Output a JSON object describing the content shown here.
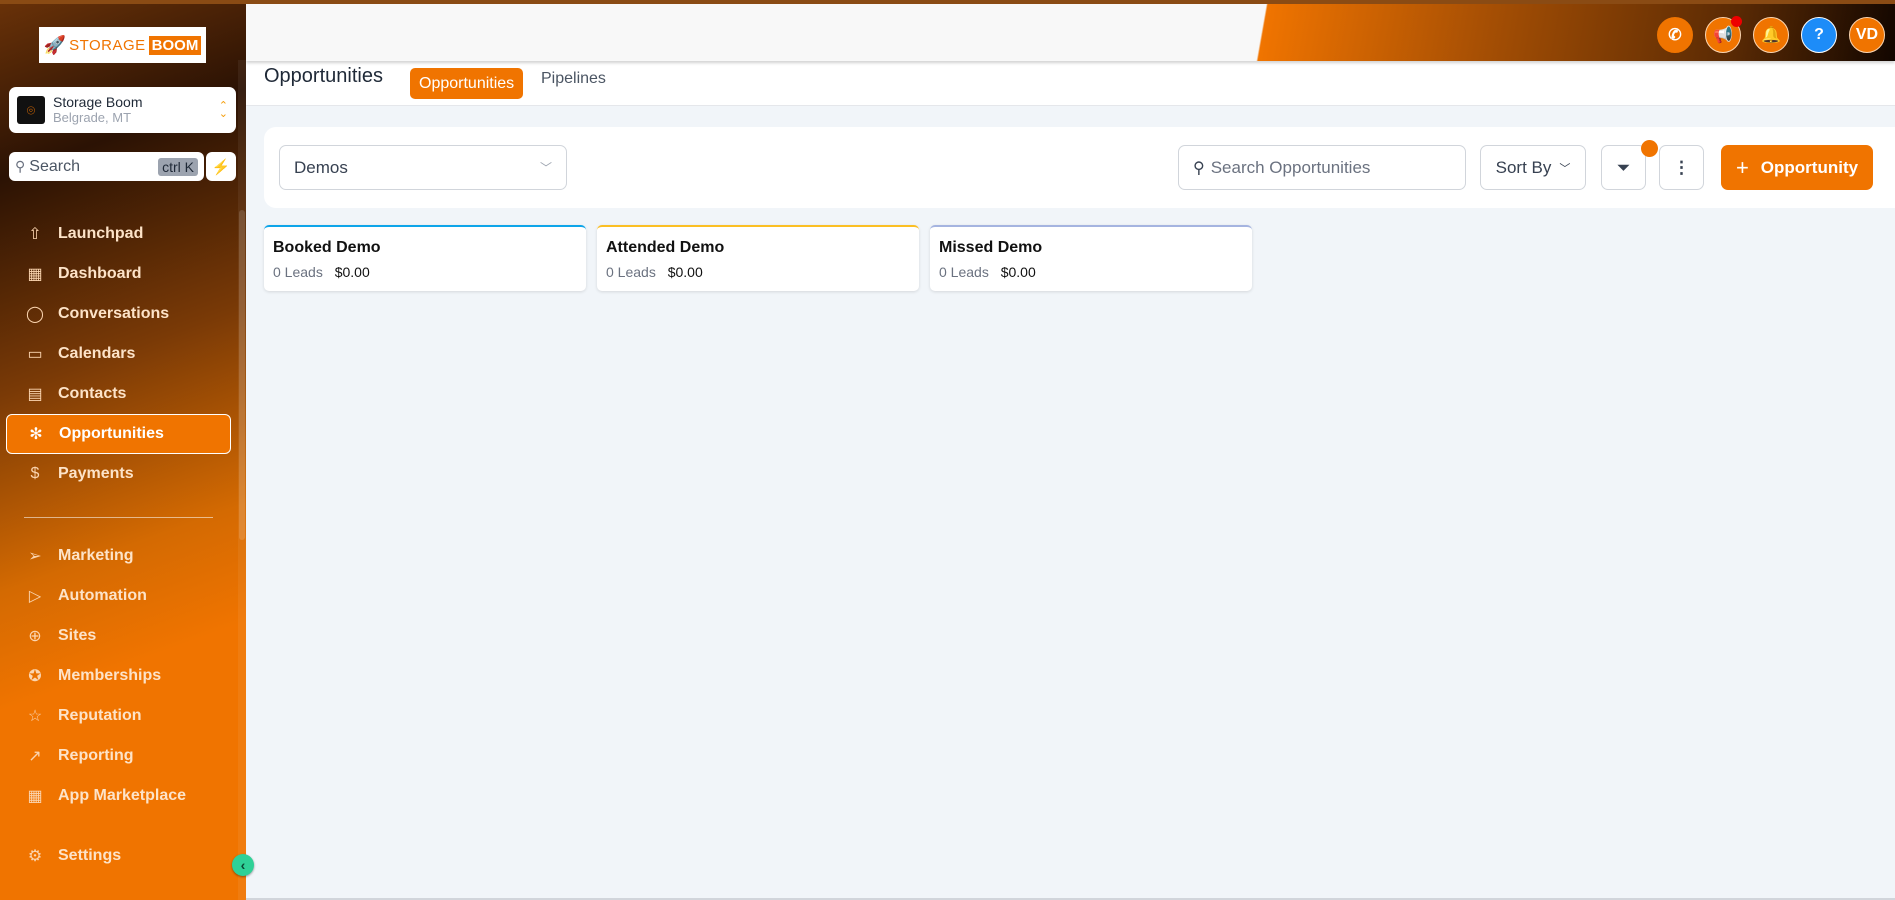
{
  "brand": {
    "logo_text_light": "STORAGE",
    "logo_text_bold": "BOOM",
    "accent_color": "#f07400"
  },
  "location": {
    "name": "Storage Boom",
    "city": "Belgrade, MT"
  },
  "sidebar_search": {
    "label": "Search",
    "shortcut": "ctrl K"
  },
  "sidebar": {
    "items": [
      {
        "label": "Launchpad",
        "icon": "rocket-launch-icon"
      },
      {
        "label": "Dashboard",
        "icon": "dashboard-grid-icon"
      },
      {
        "label": "Conversations",
        "icon": "chat-bubble-icon"
      },
      {
        "label": "Calendars",
        "icon": "calendar-icon"
      },
      {
        "label": "Contacts",
        "icon": "contact-book-icon"
      },
      {
        "label": "Opportunities",
        "icon": "opportunities-icon",
        "active": true
      },
      {
        "label": "Payments",
        "icon": "payment-receipt-icon"
      }
    ],
    "items_secondary": [
      {
        "label": "Marketing",
        "icon": "send-icon"
      },
      {
        "label": "Automation",
        "icon": "play-circle-icon"
      },
      {
        "label": "Sites",
        "icon": "website-icon"
      },
      {
        "label": "Memberships",
        "icon": "badge-icon"
      },
      {
        "label": "Reputation",
        "icon": "star-icon"
      },
      {
        "label": "Reporting",
        "icon": "trend-up-icon"
      },
      {
        "label": "App Marketplace",
        "icon": "apps-grid-icon"
      }
    ],
    "settings_label": "Settings"
  },
  "header": {
    "avatar_initials": "VD",
    "icons": [
      "phone-icon",
      "megaphone-icon",
      "bell-icon",
      "help-icon",
      "avatar"
    ]
  },
  "page": {
    "title": "Opportunities",
    "tabs": [
      {
        "label": "Opportunities",
        "active": true
      },
      {
        "label": "Pipelines",
        "active": false
      }
    ]
  },
  "toolbar": {
    "pipeline_selected": "Demos",
    "search_placeholder": "Search Opportunities",
    "search_value": "",
    "sort_label": "Sort By",
    "add_label": "Opportunity"
  },
  "stages": [
    {
      "name": "Booked Demo",
      "leads": "0 Leads",
      "value": "$0.00",
      "color": "#0ea5e9"
    },
    {
      "name": "Attended Demo",
      "leads": "0 Leads",
      "value": "$0.00",
      "color": "#fbbf24"
    },
    {
      "name": "Missed Demo",
      "leads": "0 Leads",
      "value": "$0.00",
      "color": "#a5b4e0"
    }
  ]
}
